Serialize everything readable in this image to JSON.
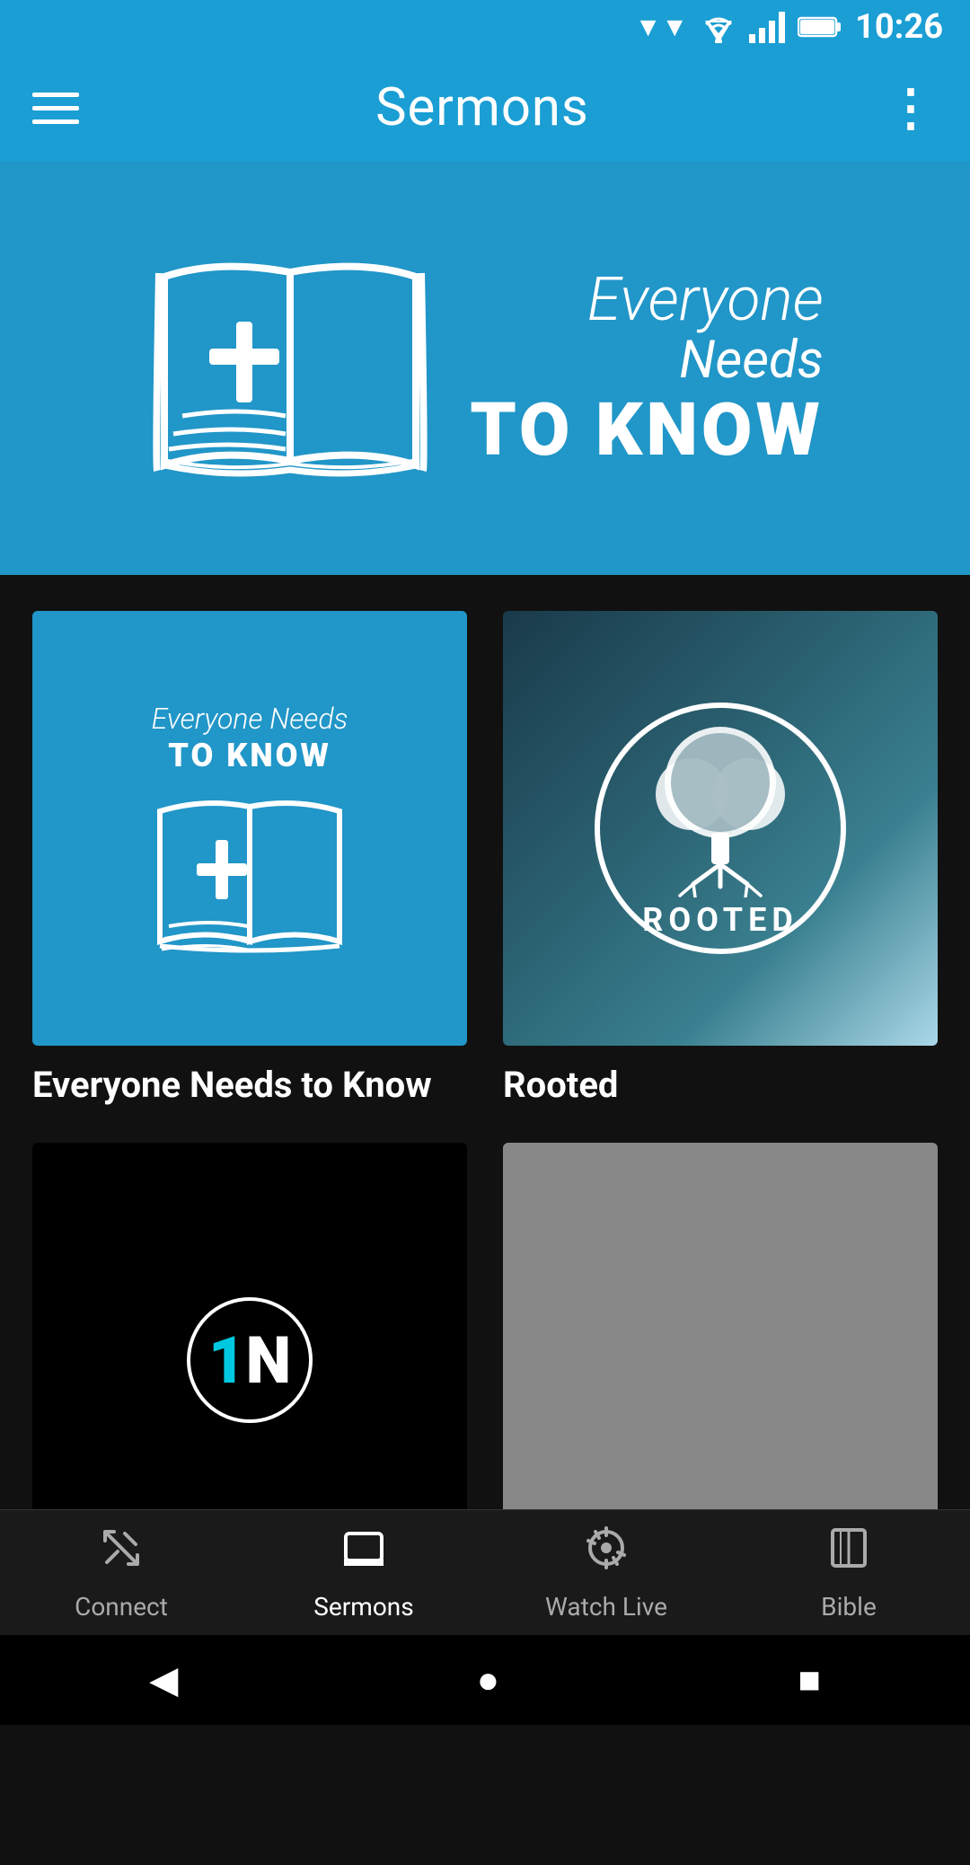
{
  "statusBar": {
    "time": "10:26"
  },
  "appBar": {
    "title": "Sermons",
    "moreLabel": "⋮"
  },
  "heroBanner": {
    "line1": "Everyone",
    "line2": "Needs",
    "line3": "TO KNOW"
  },
  "sermons": [
    {
      "id": "entk",
      "title": "Everyone Needs to Know",
      "type": "entk"
    },
    {
      "id": "rooted",
      "title": "Rooted",
      "type": "rooted"
    },
    {
      "id": "onenation",
      "title": "",
      "type": "onenation"
    },
    {
      "id": "gray",
      "title": "",
      "type": "gray"
    }
  ],
  "bottomNav": {
    "items": [
      {
        "id": "connect",
        "label": "Connect",
        "active": false
      },
      {
        "id": "sermons",
        "label": "Sermons",
        "active": true
      },
      {
        "id": "watchlive",
        "label": "Watch Live",
        "active": false
      },
      {
        "id": "bible",
        "label": "Bible",
        "active": false
      }
    ]
  },
  "systemNav": {
    "back": "◀",
    "home": "●",
    "recent": "■"
  }
}
